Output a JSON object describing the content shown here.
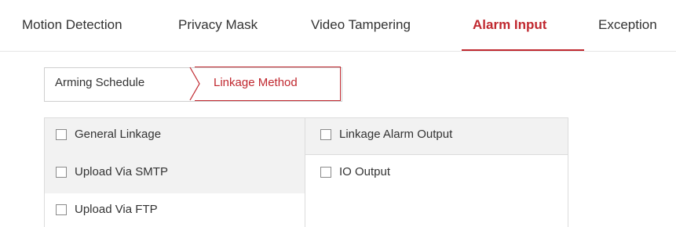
{
  "tabs": [
    {
      "label": "Motion Detection"
    },
    {
      "label": "Privacy Mask"
    },
    {
      "label": "Video Tampering"
    },
    {
      "label": "Alarm Input",
      "active": true
    },
    {
      "label": "Exception"
    }
  ],
  "subtabs": [
    {
      "label": "Arming Schedule"
    },
    {
      "label": "Linkage Method",
      "active": true
    }
  ],
  "linkage": {
    "left": [
      {
        "label": "General Linkage",
        "checked": false
      },
      {
        "label": "Upload Via SMTP",
        "checked": false
      },
      {
        "label": "Upload Via FTP",
        "checked": false
      }
    ],
    "right": [
      {
        "label": "Linkage Alarm Output",
        "checked": false
      },
      {
        "label": "IO Output",
        "checked": false
      }
    ]
  },
  "colors": {
    "accent": "#c0282f",
    "row_background": "#f2f2f2",
    "border": "#dcdcdc"
  }
}
